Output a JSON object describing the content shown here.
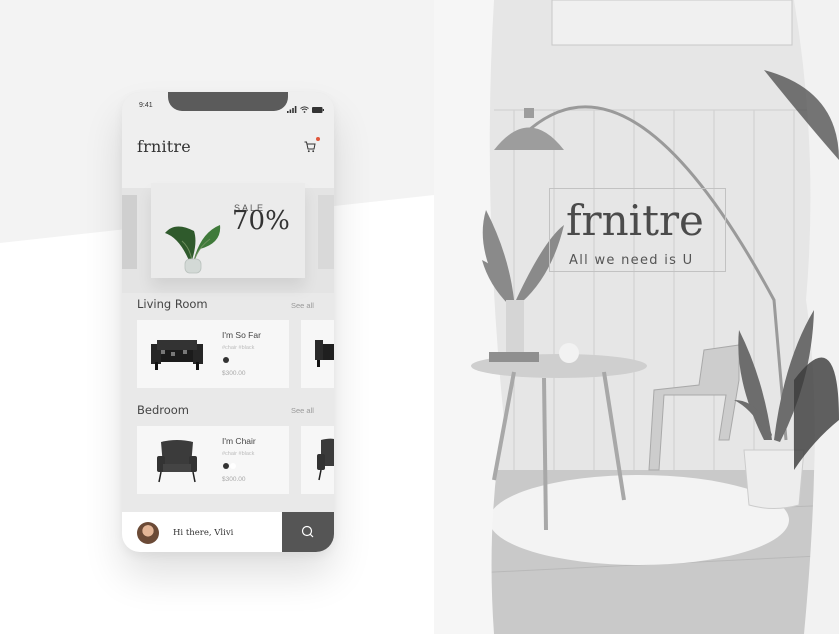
{
  "status": {
    "time": "9:41"
  },
  "brand": "frnitre",
  "banner": {
    "sale_label": "SALE",
    "sale_value": "70%"
  },
  "sections": [
    {
      "title": "Living Room",
      "see_all": "See all",
      "item": {
        "title": "I'm So Far",
        "tags": "#chair #black",
        "price": "$300.00"
      }
    },
    {
      "title": "Bedroom",
      "see_all": "See all",
      "item": {
        "title": "I'm Chair",
        "tags": "#chair #black",
        "price": "$300.00"
      }
    }
  ],
  "footer": {
    "greeting": "Hi there, Vlivi"
  },
  "photo": {
    "brand": "frnitre",
    "tagline": "All we need is U"
  },
  "icons": {
    "cart": "shopping-cart-icon",
    "search": "search-icon",
    "signal": "signal-icon",
    "wifi": "wifi-icon",
    "battery": "battery-icon"
  },
  "colors": {
    "accent_dot": "#e0573b",
    "search_button": "#555555"
  }
}
